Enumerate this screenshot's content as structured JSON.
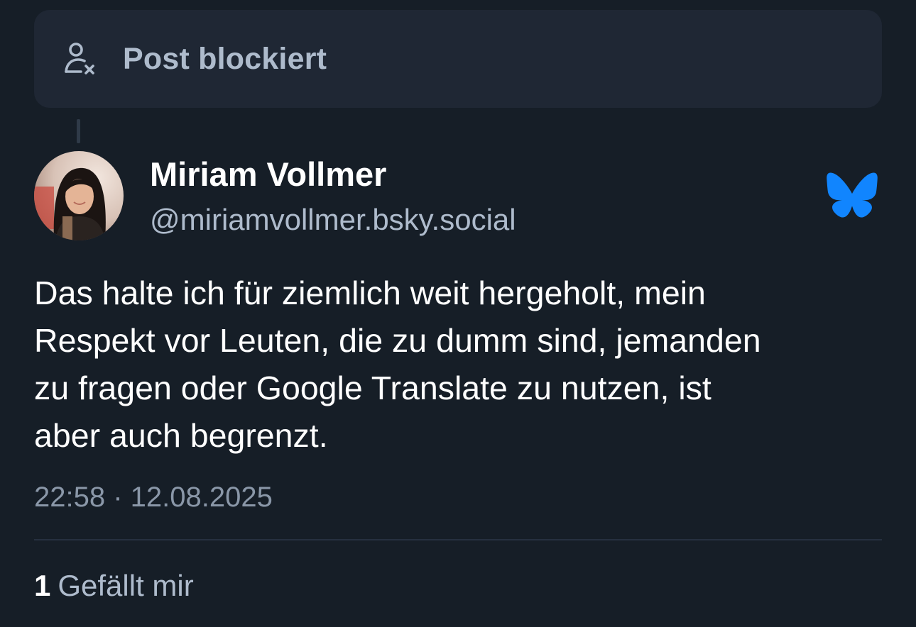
{
  "blocked_notice": {
    "label": "Post blockiert",
    "icon": "person-blocked-icon"
  },
  "post": {
    "author": {
      "name": "Miriam Vollmer",
      "handle": "@miriamvollmer.bsky.social",
      "avatar": "avatar-photo"
    },
    "text_lines": [
      "Das halte ich für ziemlich weit hergeholt, mein",
      "Respekt vor Leuten, die zu dumm sind, jemanden",
      "zu fragen oder Google Translate zu nutzen, ist",
      "aber auch begrenzt."
    ],
    "timestamp": "22:58 · 12.08.2025",
    "likes": {
      "count": "1",
      "label": "Gefällt mir"
    }
  },
  "brand": {
    "icon": "bluesky-butterfly-icon",
    "color": "#1185fe"
  },
  "colors": {
    "background": "#161e27",
    "card": "#1f2734",
    "muted_text": "#aebbcc",
    "timestamp_text": "#8a97a8"
  }
}
